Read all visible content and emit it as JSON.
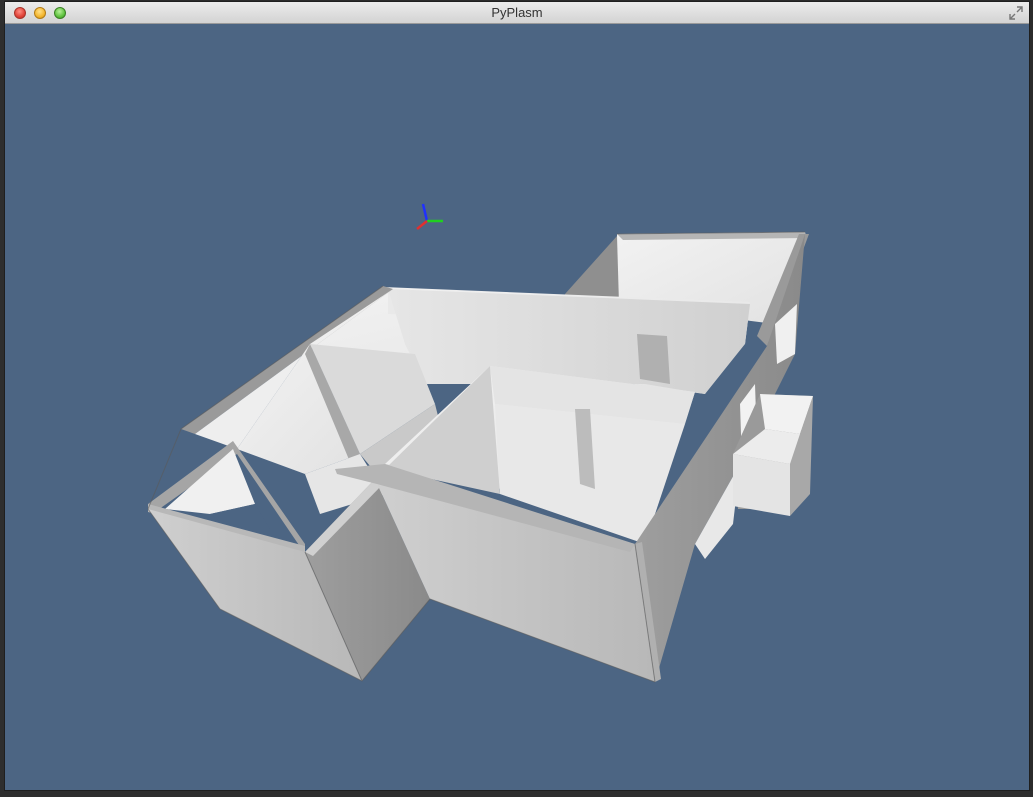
{
  "window": {
    "title": "PyPlasm",
    "background_color": "#4c6583"
  },
  "controls": {
    "close_icon": "close-icon",
    "minimize_icon": "minimize-icon",
    "zoom_icon": "zoom-icon",
    "fullscreen_icon": "fullscreen-icon"
  },
  "axes_colors": {
    "x": "#e03030",
    "y": "#20d020",
    "z": "#2030ff"
  }
}
